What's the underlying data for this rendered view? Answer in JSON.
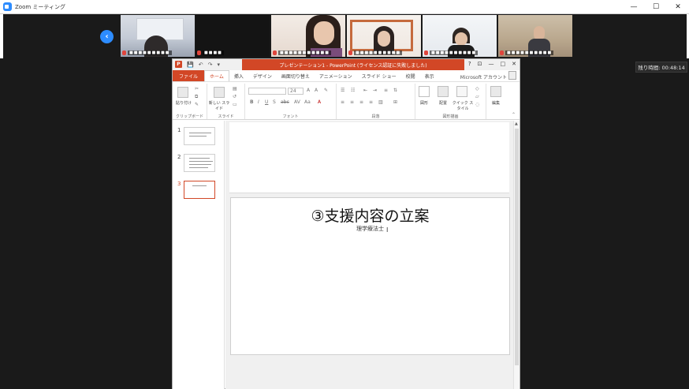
{
  "zoom": {
    "title": "Zoom ミーティング",
    "controls": {
      "minimize": "—",
      "maximize": "☐",
      "close": "✕"
    },
    "prev_arrow": "‹",
    "participants": [
      {
        "name": "■■■■■■■■■",
        "muted": true
      },
      {
        "name": "■■■■",
        "muted": true
      },
      {
        "name": "■■■■■■■■■■■",
        "muted": true
      },
      {
        "name": "■■■■■■■■■■",
        "muted": true
      },
      {
        "name": "■■■■■■■■■■",
        "muted": true
      },
      {
        "name": "■■■■■■■■■■",
        "muted": true
      }
    ],
    "timer": "残り時間: 00:48:14"
  },
  "powerpoint": {
    "title": "プレゼンテーション1 - PowerPoint (ライセンス認証に失敗しました)",
    "quick_access": {
      "save": "💾",
      "undo": "↶",
      "redo": "↷",
      "customize": "▾"
    },
    "window_controls": {
      "help": "?",
      "ribbon_opts": "⊡",
      "minimize": "—",
      "restore": "□",
      "close": "✕"
    },
    "tabs": {
      "file": "ファイル",
      "home": "ホーム",
      "insert": "挿入",
      "design": "デザイン",
      "transitions": "画面切り替え",
      "animations": "アニメーション",
      "slideshow": "スライド ショー",
      "review": "校閲",
      "view": "表示"
    },
    "account": "Microsoft アカウント",
    "ribbon": {
      "paste": "貼り付け",
      "clipboard": "クリップボード",
      "new_slide": "新しい スライド",
      "slides": "スライド",
      "font_size": "24",
      "font": "フォント",
      "paragraph": "段落",
      "shape": "図形",
      "arrange": "配置",
      "quick_style": "クイック スタイル",
      "drawing": "図形描画",
      "editing": "編集"
    },
    "slide_numbers": [
      "1",
      "2",
      "3"
    ],
    "slide": {
      "title": "③支援内容の立案",
      "subtitle": "理学療法士"
    }
  }
}
